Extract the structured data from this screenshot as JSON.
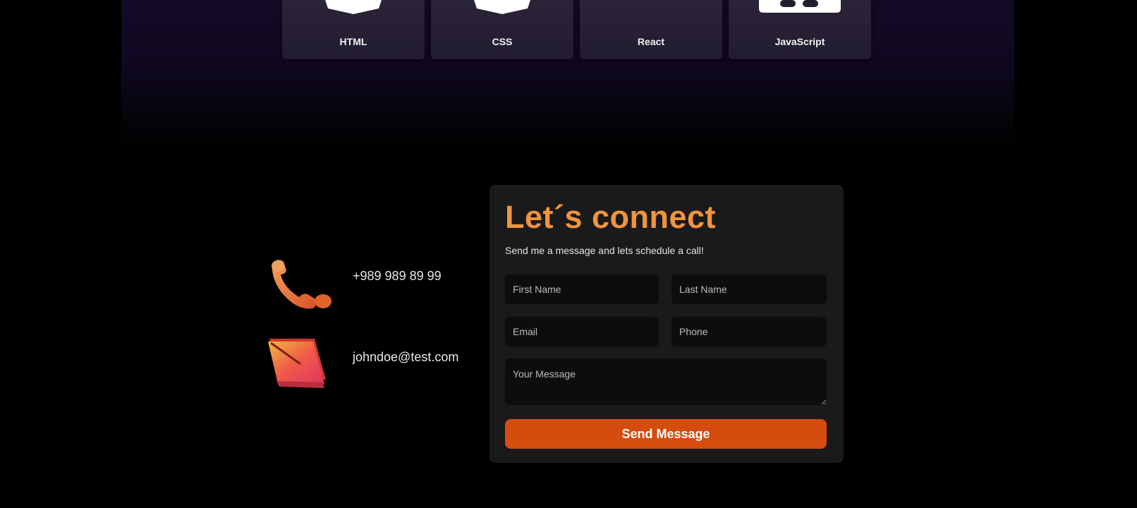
{
  "skills": [
    {
      "label": "HTML",
      "icon": "html5-shield-icon"
    },
    {
      "label": "CSS",
      "icon": "css3-shield-icon"
    },
    {
      "label": "React",
      "icon": "react-icon"
    },
    {
      "label": "JavaScript",
      "icon": "javascript-icon"
    }
  ],
  "contact": {
    "phone": "+989 989 89 99",
    "phone_icon": "telephone-icon",
    "email": "johndoe@test.com",
    "email_icon": "envelope-icon"
  },
  "form": {
    "title": "Let´s connect",
    "subtitle": "Send me a message and lets schedule a call!",
    "first_name_placeholder": "First Name",
    "last_name_placeholder": "Last Name",
    "email_placeholder": "Email",
    "phone_placeholder": "Phone",
    "message_placeholder": "Your Message",
    "submit_label": "Send Message"
  },
  "colors": {
    "accent_orange": "#f0943d",
    "button": "#d54c0f",
    "card_background": "#1a1a1b",
    "skill_card": "#261f33"
  }
}
